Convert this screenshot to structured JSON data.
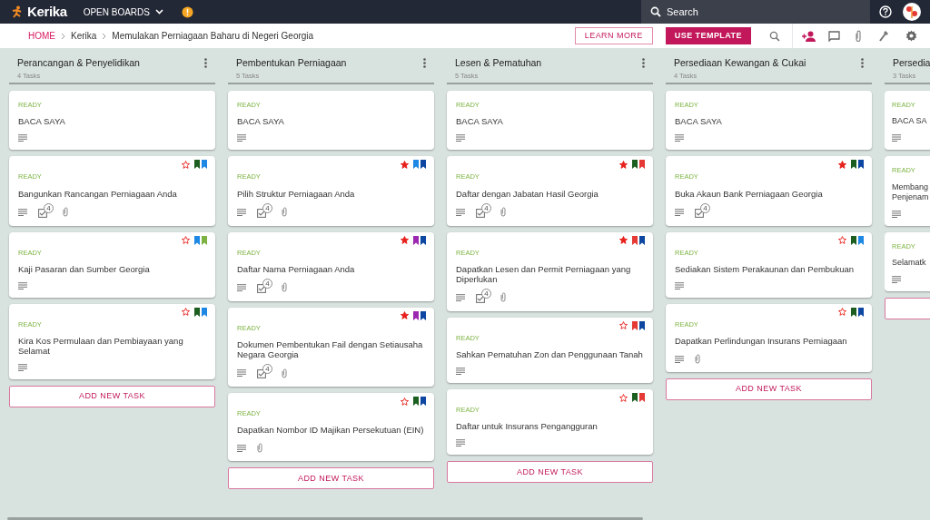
{
  "topbar": {
    "logo": "Kerika",
    "boards_menu": "OPEN BOARDS",
    "search_placeholder": "Search"
  },
  "breadcrumbs": [
    {
      "label": "HOME",
      "kind": "link"
    },
    {
      "label": "Kerika",
      "kind": "crumb"
    },
    {
      "label": "Memulakan Perniagaan Baharu di Negeri Georgia",
      "kind": "crumb"
    }
  ],
  "actions": {
    "learn_more": "LEARN MORE",
    "use_template": "USE TEMPLATE"
  },
  "columns": [
    {
      "title": "Perancangan & Penyelidikan",
      "count": "4 Tasks",
      "menu": true,
      "add_label": "ADD NEW TASK",
      "cards": [
        {
          "status": "READY",
          "title": "BACA SAYA",
          "indicators": [
            {
              "kind": "description"
            }
          ]
        },
        {
          "status": "READY",
          "title": "Bangunkan Rancangan Perniagaan Anda",
          "starred": false,
          "tags": [
            {
              "color": "#1b5e20"
            },
            {
              "color": "#1e88e5"
            }
          ],
          "indicators": [
            {
              "kind": "description"
            },
            {
              "kind": "checklist",
              "count": "4"
            },
            {
              "kind": "attachment"
            }
          ]
        },
        {
          "status": "READY",
          "title": "Kaji Pasaran dan Sumber Georgia",
          "starred": false,
          "tags": [
            {
              "color": "#1e88e5"
            },
            {
              "color": "#7cb342"
            }
          ],
          "indicators": [
            {
              "kind": "description"
            }
          ]
        },
        {
          "status": "READY",
          "title": "Kira Kos Permulaan dan Pembiayaan yang Selamat",
          "starred": false,
          "tags": [
            {
              "color": "#1b5e20"
            },
            {
              "color": "#1e88e5"
            }
          ],
          "indicators": [
            {
              "kind": "description"
            }
          ]
        }
      ]
    },
    {
      "title": "Pembentukan Perniagaan",
      "count": "5 Tasks",
      "menu": true,
      "add_label": "ADD NEW TASK",
      "cards": [
        {
          "status": "READY",
          "title": "BACA SAYA",
          "indicators": [
            {
              "kind": "description"
            }
          ]
        },
        {
          "status": "READY",
          "title": "Pilih Struktur Perniagaan Anda",
          "starred": true,
          "tags": [
            {
              "color": "#1e88e5"
            },
            {
              "color": "#0d47a1"
            }
          ],
          "indicators": [
            {
              "kind": "description"
            },
            {
              "kind": "checklist",
              "count": "4"
            },
            {
              "kind": "attachment"
            }
          ]
        },
        {
          "status": "READY",
          "title": "Daftar Nama Perniagaan Anda",
          "starred": true,
          "tags": [
            {
              "color": "#9c27b0"
            },
            {
              "color": "#0d47a1"
            }
          ],
          "indicators": [
            {
              "kind": "description"
            },
            {
              "kind": "checklist",
              "count": "4"
            },
            {
              "kind": "attachment"
            }
          ]
        },
        {
          "status": "READY",
          "title": "Dokumen Pembentukan Fail dengan Setiausaha Negara Georgia",
          "starred": true,
          "tags": [
            {
              "color": "#9c27b0"
            },
            {
              "color": "#0d47a1"
            }
          ],
          "indicators": [
            {
              "kind": "description"
            },
            {
              "kind": "checklist",
              "count": "4"
            },
            {
              "kind": "attachment"
            }
          ]
        },
        {
          "status": "READY",
          "title": "Dapatkan Nombor ID Majikan Persekutuan (EIN)",
          "starred": false,
          "tags": [
            {
              "color": "#1b5e20"
            },
            {
              "color": "#0d47a1"
            }
          ],
          "indicators": [
            {
              "kind": "description"
            },
            {
              "kind": "attachment"
            }
          ]
        }
      ]
    },
    {
      "title": "Lesen & Pematuhan",
      "count": "5 Tasks",
      "menu": true,
      "add_label": "ADD NEW TASK",
      "cards": [
        {
          "status": "READY",
          "title": "BACA SAYA",
          "indicators": [
            {
              "kind": "description"
            }
          ]
        },
        {
          "status": "READY",
          "title": "Daftar dengan Jabatan Hasil Georgia",
          "starred": true,
          "tags": [
            {
              "color": "#1b5e20"
            },
            {
              "color": "#e53935"
            }
          ],
          "indicators": [
            {
              "kind": "description"
            },
            {
              "kind": "checklist",
              "count": "4"
            },
            {
              "kind": "attachment"
            }
          ]
        },
        {
          "status": "READY",
          "title": "Dapatkan Lesen dan Permit Perniagaan yang Diperlukan",
          "starred": true,
          "tags": [
            {
              "color": "#e53935"
            },
            {
              "color": "#0d47a1"
            }
          ],
          "indicators": [
            {
              "kind": "description"
            },
            {
              "kind": "checklist",
              "count": "4"
            },
            {
              "kind": "attachment"
            }
          ]
        },
        {
          "status": "READY",
          "title": "Sahkan Pematuhan Zon dan Penggunaan Tanah",
          "starred": false,
          "tags": [
            {
              "color": "#e53935"
            },
            {
              "color": "#0d47a1"
            }
          ],
          "indicators": [
            {
              "kind": "description"
            }
          ]
        },
        {
          "status": "READY",
          "title": "Daftar untuk Insurans Pengangguran",
          "starred": false,
          "tags": [
            {
              "color": "#1b5e20"
            },
            {
              "color": "#e53935"
            }
          ],
          "indicators": [
            {
              "kind": "description"
            }
          ]
        }
      ]
    },
    {
      "title": "Persediaan Kewangan & Cukai",
      "count": "4 Tasks",
      "menu": true,
      "add_label": "ADD NEW TASK",
      "cards": [
        {
          "status": "READY",
          "title": "BACA SAYA",
          "indicators": [
            {
              "kind": "description"
            }
          ]
        },
        {
          "status": "READY",
          "title": "Buka Akaun Bank Perniagaan Georgia",
          "starred": true,
          "tags": [
            {
              "color": "#1b5e20"
            },
            {
              "color": "#0d47a1"
            }
          ],
          "indicators": [
            {
              "kind": "description"
            },
            {
              "kind": "checklist",
              "count": "4"
            }
          ]
        },
        {
          "status": "READY",
          "title": "Sediakan Sistem Perakaunan dan Pembukuan",
          "starred": false,
          "tags": [
            {
              "color": "#1b5e20"
            },
            {
              "color": "#1e88e5"
            }
          ],
          "indicators": [
            {
              "kind": "description"
            }
          ]
        },
        {
          "status": "READY",
          "title": "Dapatkan Perlindungan Insurans Perniagaan",
          "starred": false,
          "tags": [
            {
              "color": "#1b5e20"
            },
            {
              "color": "#0d47a1"
            }
          ],
          "indicators": [
            {
              "kind": "description"
            },
            {
              "kind": "attachment"
            }
          ]
        }
      ]
    },
    {
      "title": "Persedia",
      "count": "3 Tasks",
      "menu": false,
      "add_task": true,
      "cards": [
        {
          "status": "READY",
          "title": "BACA SA",
          "indicators": [
            {
              "kind": "description"
            }
          ]
        },
        {
          "status": "READY",
          "title": "Membang Penjenam",
          "indicators": [
            {
              "kind": "description"
            }
          ]
        },
        {
          "status": "READY",
          "title": "Selamatk",
          "indicators": [
            {
              "kind": "description"
            }
          ]
        }
      ]
    }
  ]
}
